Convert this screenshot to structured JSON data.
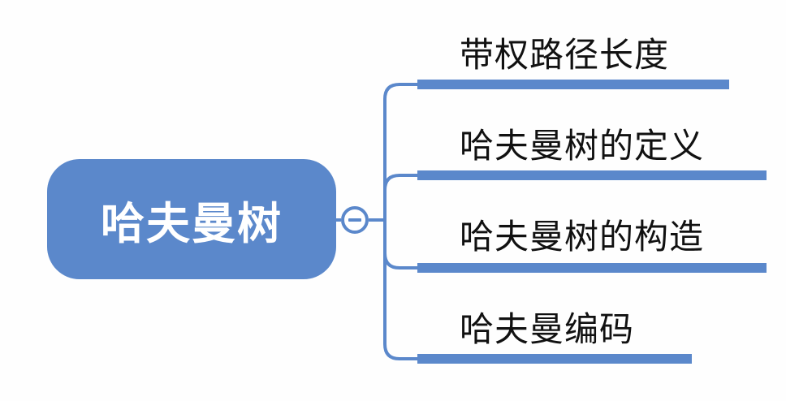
{
  "root": {
    "label": "哈夫曼树"
  },
  "branches": [
    {
      "label": "带权路径长度"
    },
    {
      "label": "哈夫曼树的定义"
    },
    {
      "label": "哈夫曼树的构造"
    },
    {
      "label": "哈夫曼编码"
    }
  ],
  "colors": {
    "accent": "#5b88cb",
    "text": "#111111",
    "root_text": "#ffffff"
  }
}
